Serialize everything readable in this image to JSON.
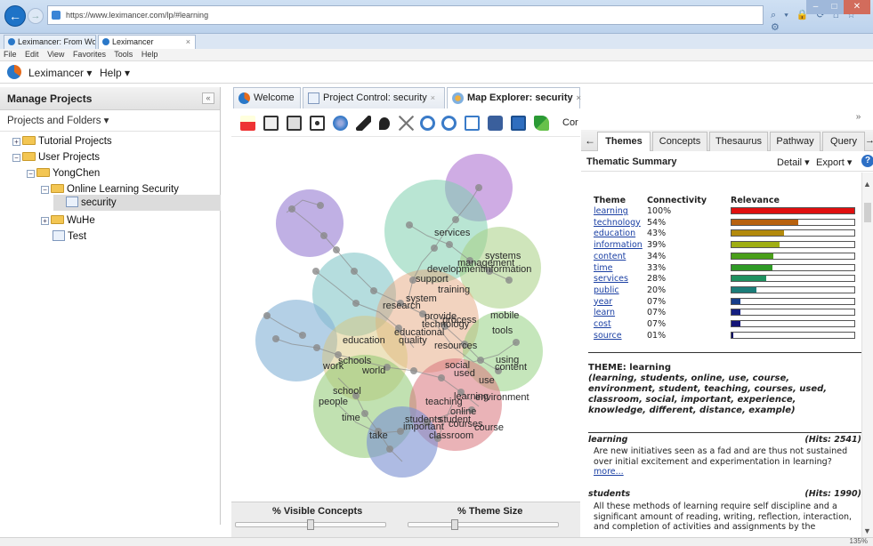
{
  "browser": {
    "url": "https://www.leximancer.com/lp/#learning",
    "tabs": [
      {
        "label": "Leximancer: From Wor..."
      },
      {
        "label": "Leximancer",
        "close": "×"
      }
    ],
    "menu": [
      "File",
      "Edit",
      "View",
      "Favorites",
      "Tools",
      "Help"
    ],
    "tools": "⌕ ▾ 🔒 ⟳ ⌂ ☆ ⚙",
    "zoom": "135%"
  },
  "app": {
    "menu_leximancer": "Leximancer ▾",
    "menu_help": "Help ▾"
  },
  "left_panel": {
    "title": "Manage Projects",
    "collapse": "«",
    "subheader": "Projects and Folders ▾",
    "tree": [
      {
        "label": "Tutorial Projects",
        "type": "folder",
        "expander": "+"
      },
      {
        "label": "User Projects",
        "type": "folder",
        "expander": "−"
      },
      {
        "label": "YongChen",
        "type": "folder",
        "expander": "−"
      },
      {
        "label": "Online Learning Security",
        "type": "folder",
        "expander": "−"
      },
      {
        "label": "security",
        "type": "doc",
        "expander": ""
      },
      {
        "label": "WuHe",
        "type": "folder",
        "expander": "+"
      },
      {
        "label": "Test",
        "type": "doc",
        "expander": ""
      }
    ]
  },
  "center_tabs": [
    {
      "label": "Welcome"
    },
    {
      "label": "Project Control: security",
      "close": "×"
    },
    {
      "label": "Map Explorer: security",
      "close": "×"
    }
  ],
  "map_toolbar_more": "Cor",
  "map": {
    "concepts": [
      "services",
      "systems",
      "management",
      "development",
      "information",
      "support",
      "training",
      "system",
      "research",
      "provide",
      "process",
      "technology",
      "educational",
      "quality",
      "mobile",
      "tools",
      "education",
      "resources",
      "using",
      "content",
      "schools",
      "work",
      "world",
      "social",
      "used",
      "use",
      "school",
      "people",
      "learning",
      "environment",
      "teaching",
      "online",
      "time",
      "students",
      "student",
      "important",
      "course",
      "courses",
      "classroom",
      "take"
    ]
  },
  "sliders": {
    "visible": "% Visible Concepts",
    "theme": "% Theme Size",
    "visible_value": 0.5,
    "theme_value": 0.3
  },
  "right_panel": {
    "collapse": "»",
    "tabs": [
      "Themes",
      "Concepts",
      "Thesaurus",
      "Pathway",
      "Query"
    ],
    "back": "←",
    "forward": "→",
    "summary_title": "Thematic Summary",
    "detail": "Detail ▾",
    "export": "Export ▾",
    "help": "?",
    "headers": {
      "theme": "Theme",
      "connectivity": "Connectivity",
      "relevance": "Relevance"
    },
    "themes": [
      {
        "name": "learning",
        "connectivity": "100%",
        "relevance": 1.0,
        "color": "#e01010"
      },
      {
        "name": "technology",
        "connectivity": "54%",
        "relevance": 0.54,
        "color": "#b8620f"
      },
      {
        "name": "education",
        "connectivity": "43%",
        "relevance": 0.43,
        "color": "#b38a0c"
      },
      {
        "name": "information",
        "connectivity": "39%",
        "relevance": 0.39,
        "color": "#9fae12"
      },
      {
        "name": "content",
        "connectivity": "34%",
        "relevance": 0.34,
        "color": "#4a9f1a"
      },
      {
        "name": "time",
        "connectivity": "33%",
        "relevance": 0.33,
        "color": "#2f9a26"
      },
      {
        "name": "services",
        "connectivity": "28%",
        "relevance": 0.28,
        "color": "#1f9160"
      },
      {
        "name": "public",
        "connectivity": "20%",
        "relevance": 0.2,
        "color": "#1b7d79"
      },
      {
        "name": "year",
        "connectivity": "07%",
        "relevance": 0.07,
        "color": "#173e8a"
      },
      {
        "name": "learn",
        "connectivity": "07%",
        "relevance": 0.07,
        "color": "#141f80"
      },
      {
        "name": "cost",
        "connectivity": "07%",
        "relevance": 0.07,
        "color": "#141577"
      },
      {
        "name": "source",
        "connectivity": "01%",
        "relevance": 0.01,
        "color": "#111166"
      }
    ],
    "theme_title": "THEME: learning",
    "theme_concepts": "(learning, students, online, use, course, environment, student, teaching, courses, used, classroom, social, important, experience, knowledge, different, distance, example)",
    "excerpts": [
      {
        "term": "learning",
        "hits": "(Hits: 2541)",
        "text": "Are new initiatives seen as a fad and are thus not sustained over initial excitement and experimentation in learning?",
        "more": "more..."
      },
      {
        "term": "students",
        "hits": "(Hits: 1990)",
        "text": "All these methods of learning require self discipline and a significant amount of reading, writing, reflection, interaction, and completion of activities and assignments by the",
        "more": ""
      }
    ]
  }
}
